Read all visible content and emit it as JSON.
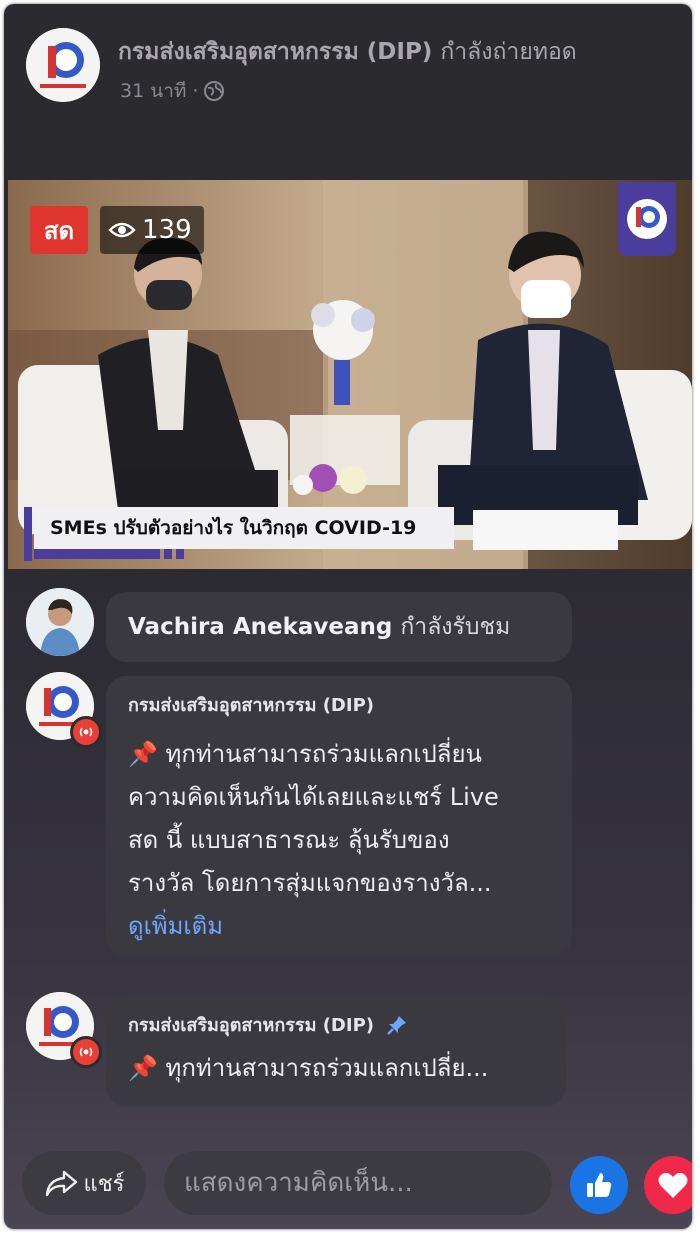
{
  "header": {
    "page_name": "กรมส่งเสริมอุตสาหกรรม (DIP)",
    "status": "กำลังถ่ายทอด",
    "time": "31 นาที",
    "separator": "·",
    "privacy_icon": "globe-icon"
  },
  "video": {
    "live_label": "สด",
    "viewer_count": "139",
    "viewer_icon": "eye-icon",
    "lower_third": "SMEs ปรับตัวอย่างไร ในวิกฤต COVID-19"
  },
  "comments": [
    {
      "type": "joined",
      "name": "Vachira Anekaveang",
      "action": "กำลังรับชม"
    },
    {
      "type": "comment",
      "author": "กรมส่งเสริมอุตสาหกรรม (DIP)",
      "emoji": "📌",
      "text": " ทุกท่านสามารถร่วมแลกเปลี่ยน\nความคิดเห็นกันได้เลยและแชร์ Live\nสด นี้ แบบสาธารณะ ลุ้นรับของ\nรางวัล โดยการสุ่มแจกของรางวัล...",
      "see_more": "ดูเพิ่มเติม"
    },
    {
      "type": "pinned",
      "author": "กรมส่งเสริมอุตสาหกรรม (DIP)",
      "emoji": "📌",
      "text": " ทุกท่านสามารถร่วมแลกเปลี่ย..."
    }
  ],
  "bottom_bar": {
    "share_label": "แชร์",
    "comment_placeholder": "แสดงความคิดเห็น...",
    "like_icon": "thumbs-up-icon",
    "love_icon": "heart-icon"
  },
  "colors": {
    "live_red": "#e0352f",
    "link_blue": "#6ea6ff",
    "like_blue": "#1b74e4",
    "love_red": "#f02849",
    "brand_purple": "#4a3d9b"
  }
}
